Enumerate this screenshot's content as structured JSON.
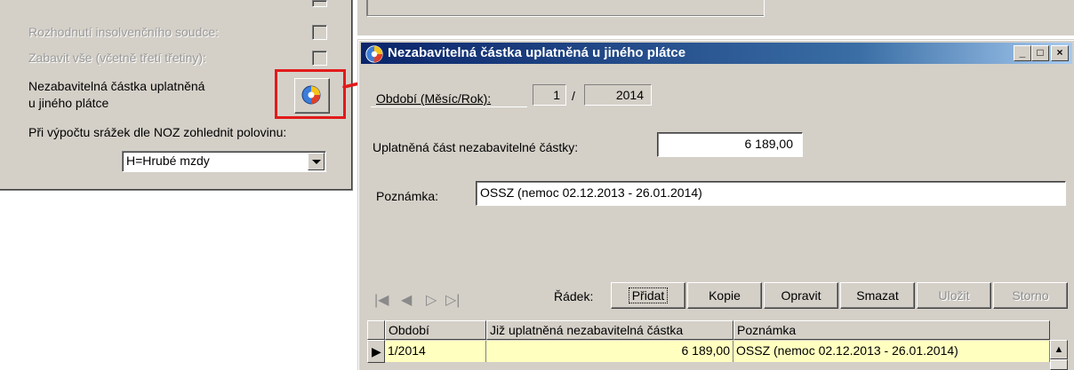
{
  "left_panel": {
    "rows": [
      {
        "label": "Rozhodnutí insolvenčního soudce:",
        "disabled": true
      },
      {
        "label": "Zabavit vše (včetně třetí třetiny):",
        "disabled": true
      }
    ],
    "exempt_label_line1": "Nezabavitelná částka uplatněná",
    "exempt_label_line2": "u jiného plátce",
    "noz_label": "Při výpočtu srážek dle NOZ zohlednit polovinu:",
    "wage_select": {
      "value": "H=Hrubé mzdy"
    },
    "highlight_color": "#e21a1a"
  },
  "dialog": {
    "title": "Nezabavitelná částka uplatněná u jiného plátce",
    "caption_buttons": [
      "_",
      "□",
      "×"
    ],
    "period": {
      "label": "Období (Měsíc/Rok):",
      "month": "1",
      "separator": "/",
      "year": "2014"
    },
    "amount": {
      "label": "Uplatněná část nezabavitelné částky:",
      "value": "6 189,00"
    },
    "note": {
      "label": "Poznámka:",
      "value": "OSSZ  (nemoc 02.12.2013 - 26.01.2014)"
    },
    "nav_icons": [
      "first-record-icon",
      "prev-record-icon",
      "next-record-icon",
      "last-record-icon"
    ],
    "toolbar": {
      "row_label": "Řádek:",
      "buttons": [
        "Přidat",
        "Kopie",
        "Opravit",
        "Smazat",
        "Uložit",
        "Storno"
      ]
    },
    "grid": {
      "headers": [
        "Období",
        "Již uplatněná nezabavitelná částka",
        "Poznámka"
      ],
      "rows": [
        [
          "1/2014",
          "6 189,00",
          "OSSZ  (nemoc 02.12.2013 - 26.01.2014)"
        ]
      ],
      "row_color": "#ffffc0"
    },
    "title_gradient": [
      "#0a246a",
      "#a6caf0"
    ]
  }
}
